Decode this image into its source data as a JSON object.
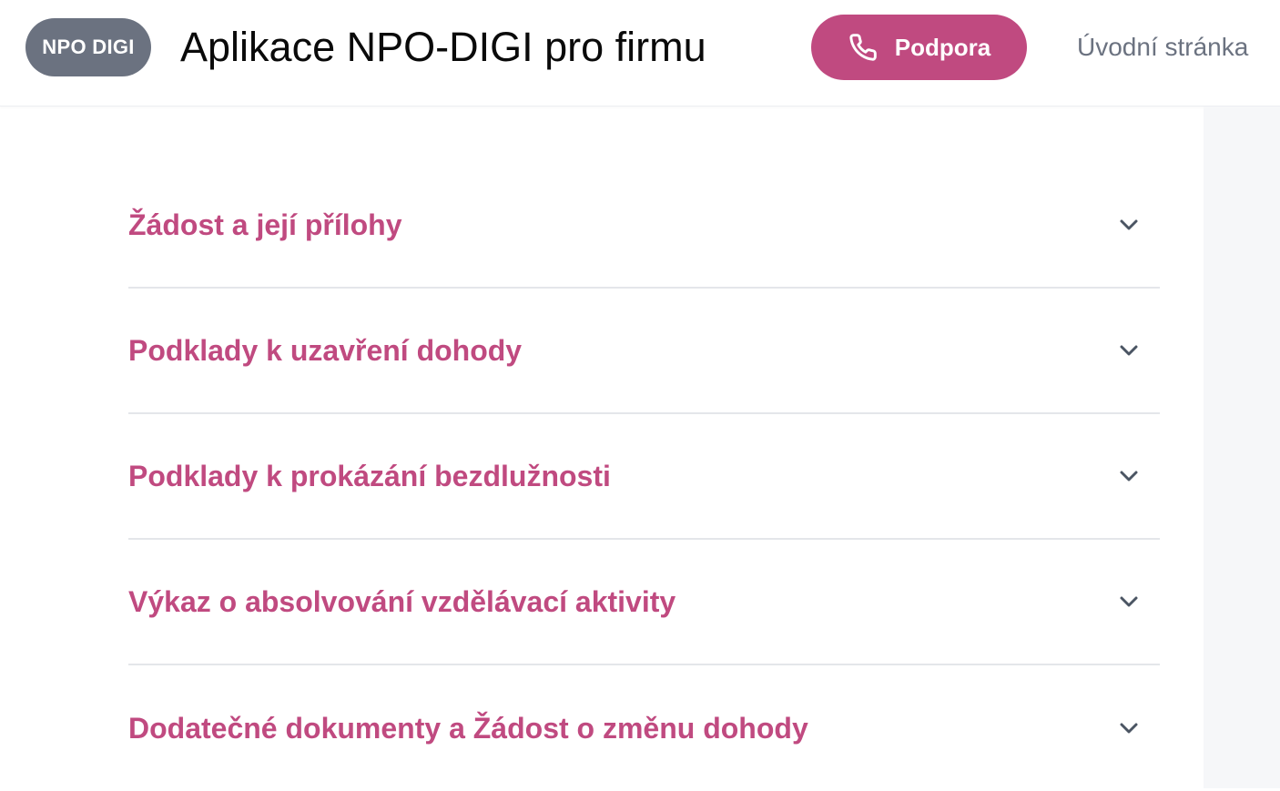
{
  "header": {
    "badge": "NPO DIGI",
    "title": "Aplikace NPO-DIGI pro firmu",
    "support_button": {
      "label": "Podpora",
      "icon": "phone-icon"
    },
    "home_link": "Úvodní stránka"
  },
  "accordion": {
    "items": [
      {
        "label": "Žádost a její přílohy",
        "icon": "chevron-down-icon"
      },
      {
        "label": "Podklady k uzavření dohody",
        "icon": "chevron-down-icon"
      },
      {
        "label": "Podklady k prokázání bezdlužnosti",
        "icon": "chevron-down-icon"
      },
      {
        "label": "Výkaz o absolvování vzdělávací aktivity",
        "icon": "chevron-down-icon"
      },
      {
        "label": "Dodatečné dokumenty a Žádost o změnu dohody",
        "icon": "chevron-down-icon"
      }
    ]
  },
  "colors": {
    "accent": "#c04a80",
    "badge_bg": "#6b7280",
    "muted_text": "#6b7280",
    "divider": "#e4e6ea",
    "chevron": "#4b5563",
    "side_panel": "#f6f7f9"
  }
}
